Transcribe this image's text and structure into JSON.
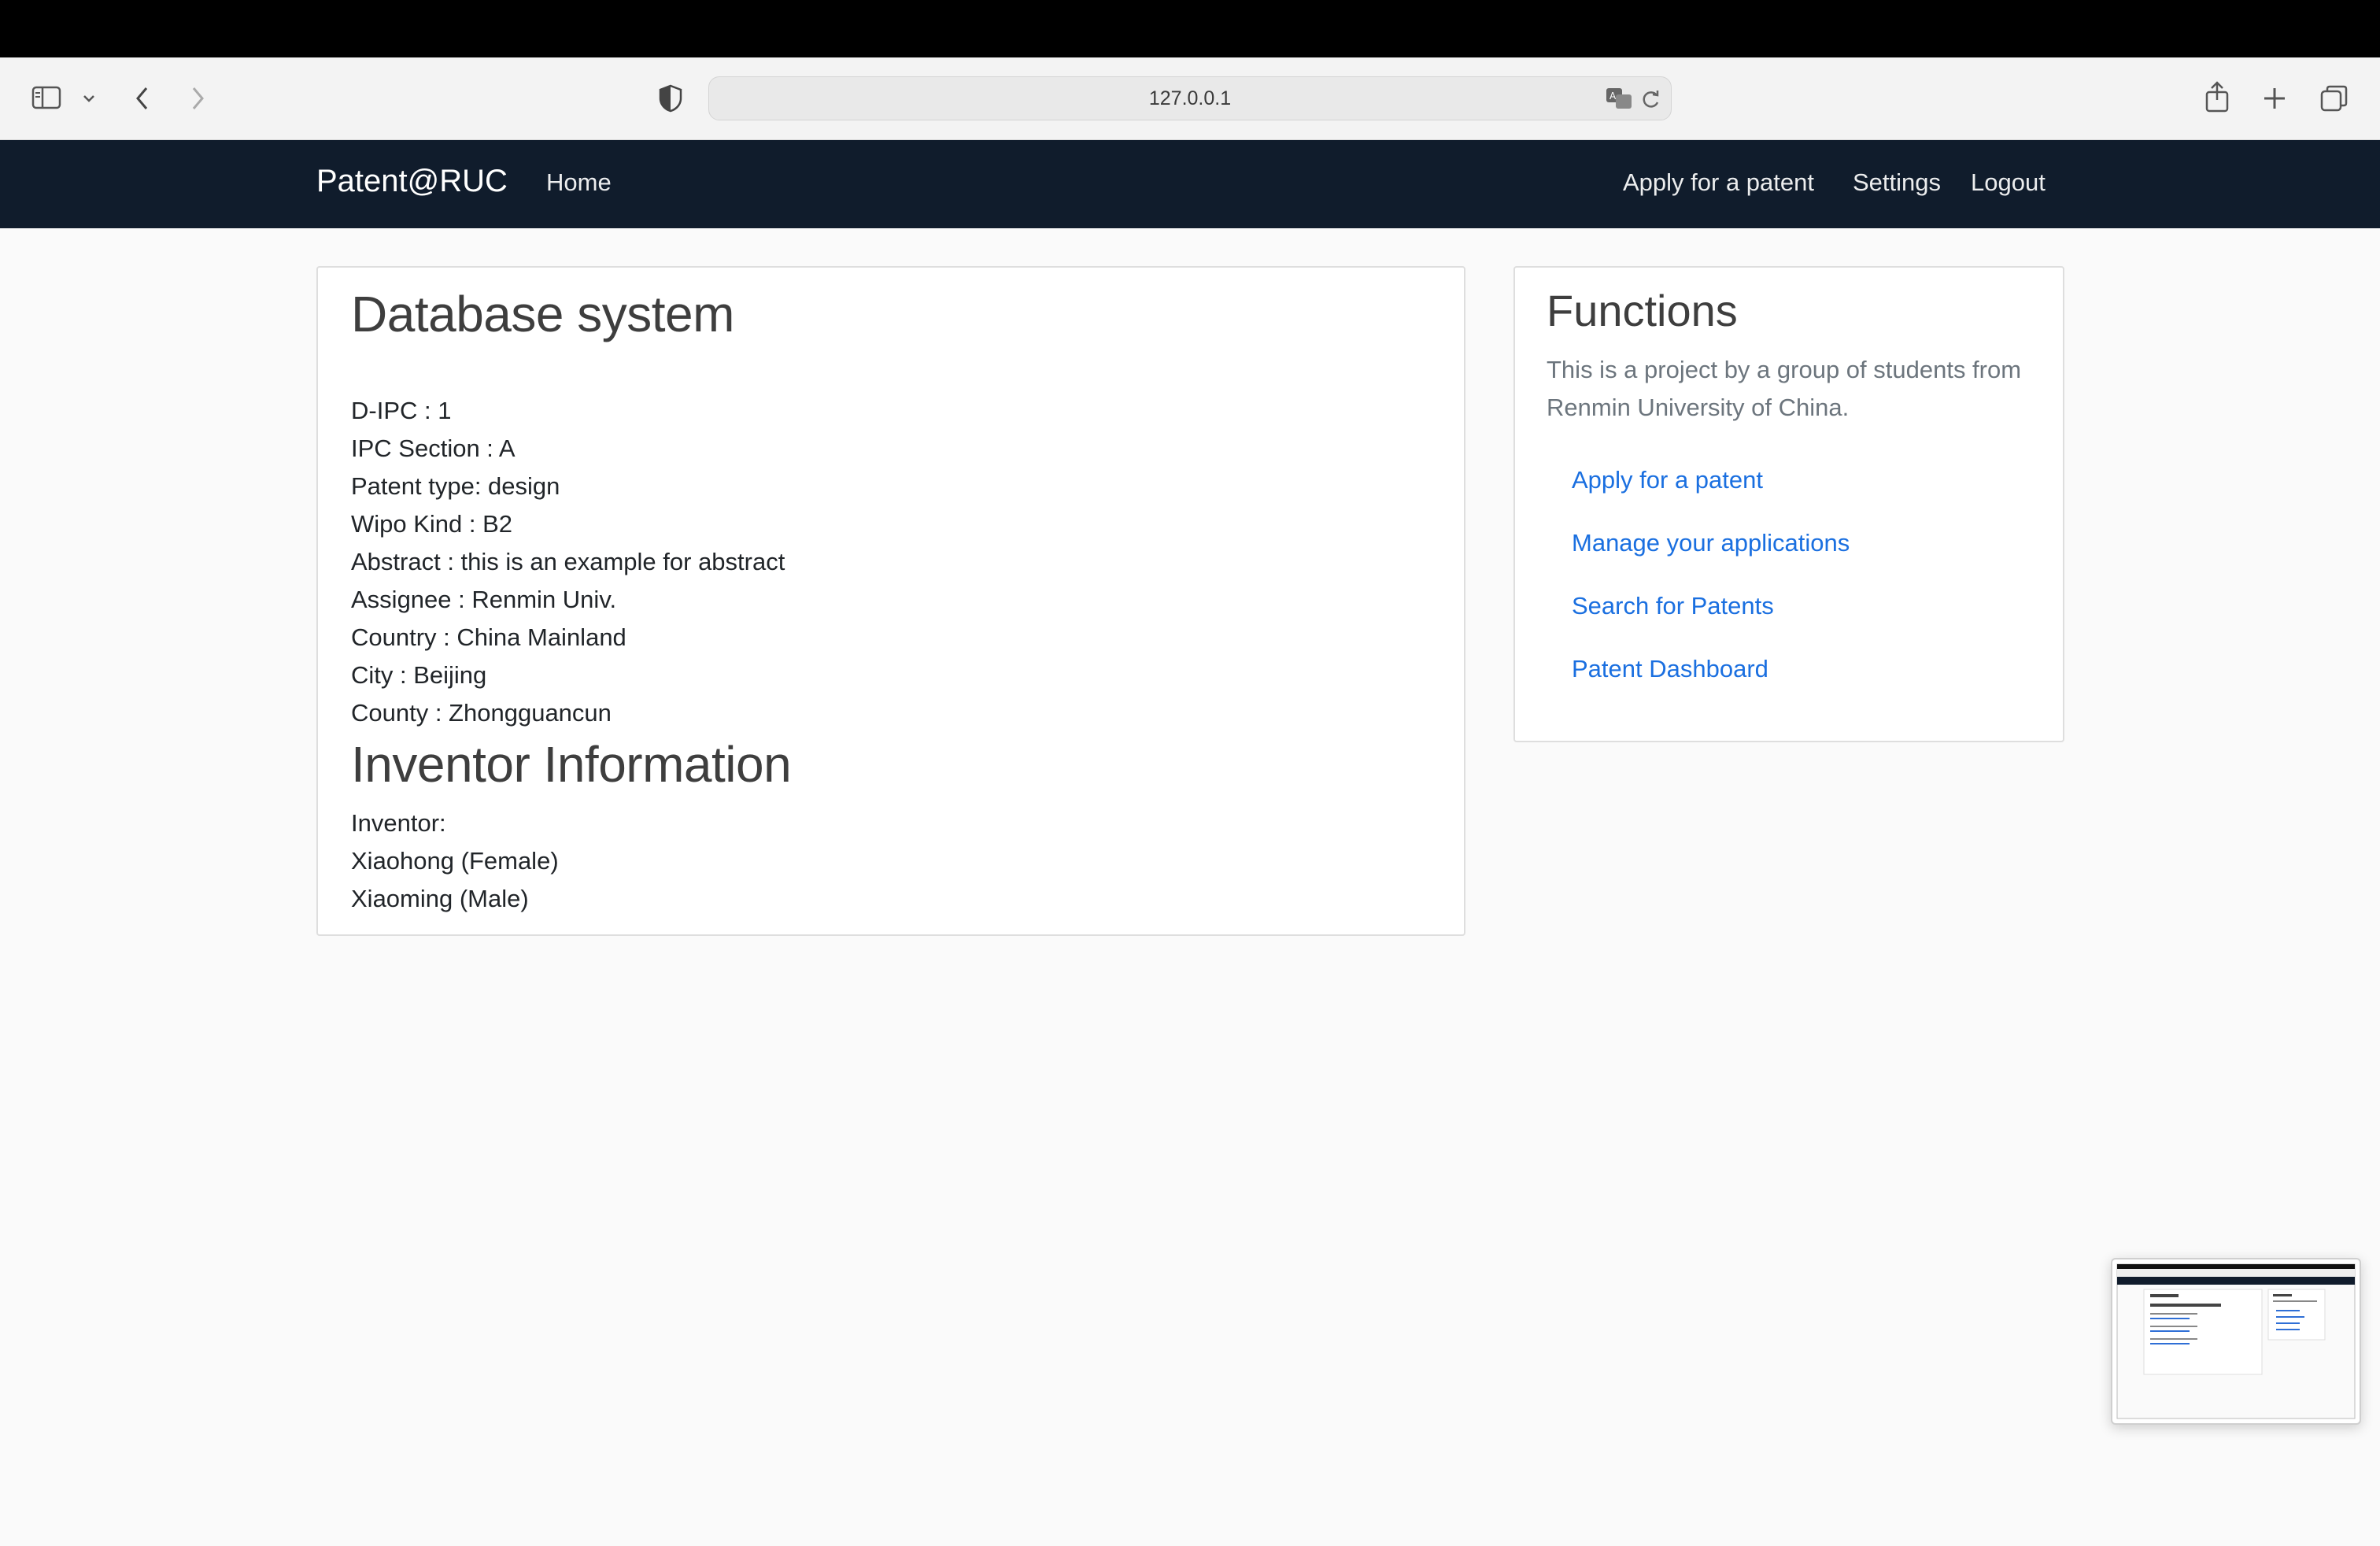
{
  "browser": {
    "url": "127.0.0.1",
    "icons": [
      "sidebar-icon",
      "chevron-down-icon",
      "back-icon",
      "forward-icon",
      "shield-icon",
      "translate-icon",
      "reload-icon",
      "share-icon",
      "new-tab-icon",
      "tabs-overview-icon"
    ]
  },
  "navbar": {
    "brand": "Patent@RUC",
    "home": "Home",
    "apply": "Apply for a patent",
    "settings": "Settings",
    "logout": "Logout"
  },
  "patent": {
    "title": "Database system",
    "lines": [
      "D-IPC : 1",
      "IPC Section : A",
      "Patent type: design",
      "Wipo Kind : B2",
      "Abstract : this is an example for abstract",
      "Assignee : Renmin Univ.",
      "Country : China Mainland",
      "City : Beijing",
      "County : Zhongguancun"
    ],
    "inventor_heading": "Inventor Information",
    "inventor_label": "Inventor:",
    "inventors": [
      "Xiaohong (Female)",
      "Xiaoming (Male)"
    ]
  },
  "functions": {
    "title": "Functions",
    "description": "This is a project by a group of students from Renmin University of China.",
    "links": [
      "Apply for a patent",
      "Manage your applications",
      "Search for Patents",
      "Patent Dashboard"
    ]
  },
  "colors": {
    "navbar": "#101c2c",
    "link": "#1a6fe0",
    "page_bg": "#fafafa"
  }
}
